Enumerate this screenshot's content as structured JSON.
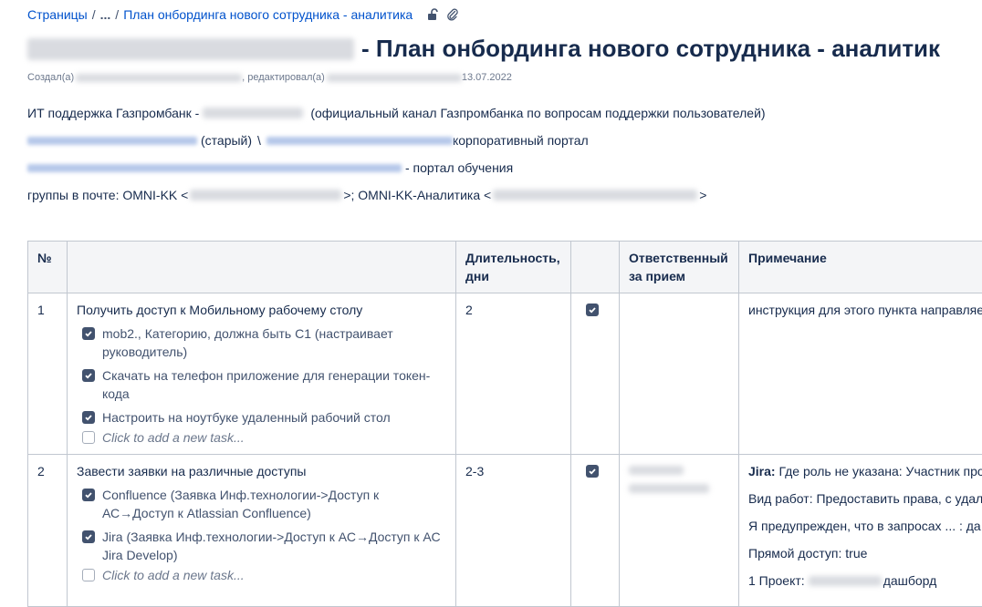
{
  "breadcrumb": {
    "root": "Страницы",
    "ellipsis": "...",
    "current": "План онбординга нового сотрудника - аналитика"
  },
  "page": {
    "title_suffix": "- План онбординга нового сотрудника - аналитик",
    "created_label": "Создал(а)",
    "edited_label": ", редактировал(а)",
    "date": "13.07.2022"
  },
  "intro": {
    "support_prefix": "ИТ поддержка Газпромбанк -",
    "support_suffix": "(официальный канал Газпромбанка по вопросам поддержки пользователей)",
    "portal_old": "(старый)",
    "portal_sep": "\\",
    "portal_suffix": "корпоративный портал",
    "learning_suffix": "- портал обучения",
    "groups_prefix": "группы в почте: OMNI-KK <",
    "groups_mid": ">; OMNI-KK-Аналитика <",
    "groups_end": ">"
  },
  "table": {
    "headers": {
      "num": "№",
      "task": "",
      "duration": "Длительность, дни",
      "check": "",
      "responsible": "Ответственный за прием",
      "note": "Примечание"
    },
    "rows": [
      {
        "num": "1",
        "title": "Получить доступ к Мобильному рабочему столу",
        "tasks": [
          "mob2., Категорию, должна быть С1 (настраивает руководитель)",
          "Скачать на телефон приложение для генерации токен-кода",
          "Настроить на ноутбуке удаленный рабочий стол"
        ],
        "placeholder": "Click to add a new task...",
        "duration": "2",
        "note": [
          "инструкция для этого пункта направляется"
        ]
      },
      {
        "num": "2",
        "title": "Завести заявки на различные доступы",
        "tasks": [
          "Confluence (Заявка Инф.технологии->Доступ к АС→Доступ к Atlassian Confluence)",
          "Jira (Заявка Инф.технологии->Доступ к АС→Доступ к АС Jira Develop)"
        ],
        "placeholder": "Click to add a new task...",
        "duration": "2-3",
        "note_jira_label": "Jira:",
        "note": [
          "Где роль не указана: Участник проекта",
          "Вид работ: Предоставить права, с удалением",
          "Я предупрежден, что в запросах ... : да",
          "Прямой доступ: true"
        ],
        "note_project_label": "1 Проект:",
        "note_project_suffix": "дашборд"
      }
    ]
  }
}
